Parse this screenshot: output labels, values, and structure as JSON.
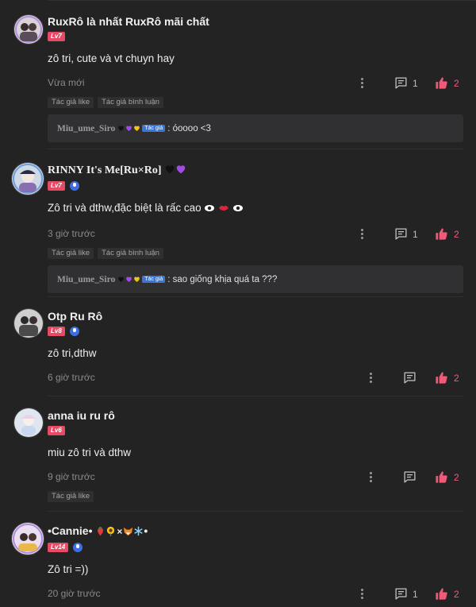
{
  "tags": {
    "author_like": "Tác giả like",
    "author_commented": "Tác giả bình luận",
    "author_badge": "Tác giả"
  },
  "comments": [
    {
      "username": "RuxRô là nhất RuxRô mãi chất",
      "level": "Lv7",
      "text": "zô tri, cute và vt chuyn hay",
      "time": "Vừa mới",
      "reply_count": "1",
      "like_count": "2",
      "reply": {
        "name": "Miu_ume_Siro",
        "text": ": óoooo <3"
      }
    },
    {
      "username": "RINNY It's Me[Ru×Ro]",
      "level": "Lv7",
      "text": "Zô tri và dthw,đặc biệt là rấc cao",
      "time": "3 giờ trước",
      "reply_count": "1",
      "like_count": "2",
      "reply": {
        "name": "Miu_ume_Siro",
        "text": ": sao giống khịa quá ta ???"
      }
    },
    {
      "username": "Otp Ru Rô",
      "level": "Lv8",
      "text": "zô tri,dthw",
      "time": "6 giờ trước",
      "like_count": "2"
    },
    {
      "username": "anna iu ru rô",
      "level": "Lv6",
      "text": "miu zô tri và dthw",
      "time": "9 giờ trước",
      "like_count": "2"
    },
    {
      "username": "•Cannie•",
      "level": "Lv14",
      "text": "Zô tri =))",
      "time": "20 giờ trước",
      "reply_count": "1",
      "like_count": "2"
    }
  ],
  "colors": {
    "background": "#232324",
    "accent_like": "#ef5a78",
    "level_badge": "#e74a65",
    "mic_badge": "#3d6ee3"
  },
  "icons": [
    "more-vertical-icon",
    "comment-icon",
    "thumbs-up-icon",
    "mic-icon",
    "heart-icon"
  ]
}
